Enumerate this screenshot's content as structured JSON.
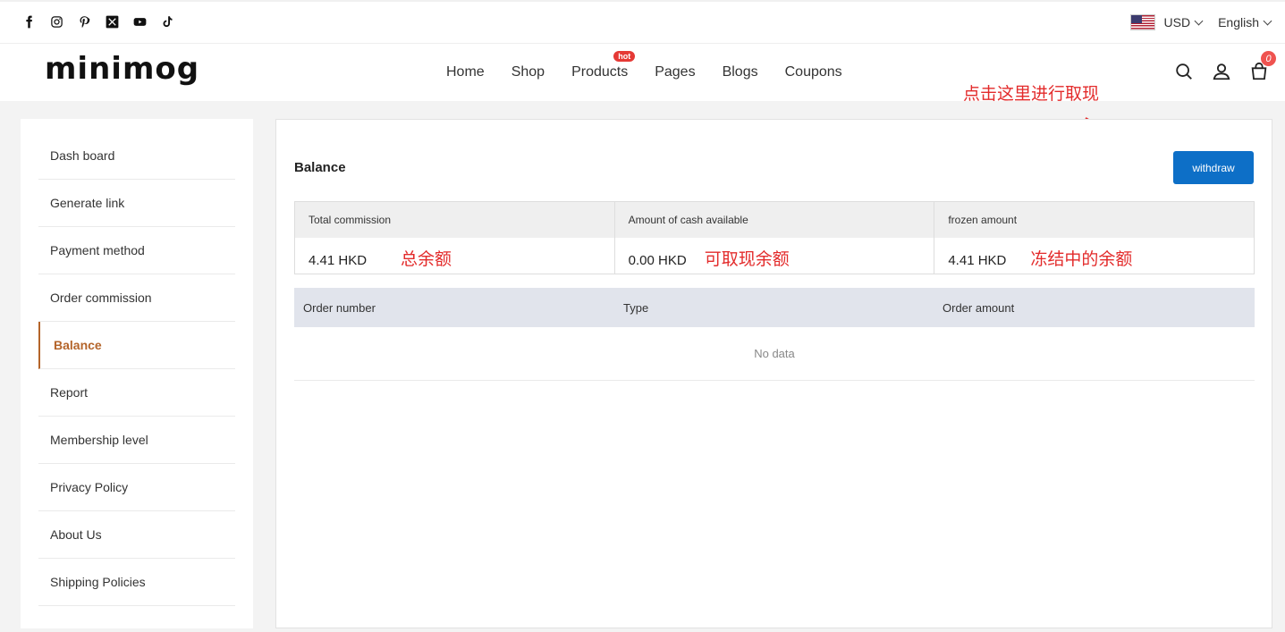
{
  "topbar": {
    "social_icons": [
      "facebook-icon",
      "instagram-icon",
      "pinterest-icon",
      "x-twitter-icon",
      "youtube-icon",
      "tiktok-icon"
    ],
    "currency": "USD",
    "language": "English"
  },
  "header": {
    "logo": "minimog",
    "nav": [
      {
        "label": "Home"
      },
      {
        "label": "Shop"
      },
      {
        "label": "Products",
        "badge": "hot"
      },
      {
        "label": "Pages"
      },
      {
        "label": "Blogs"
      },
      {
        "label": "Coupons"
      }
    ],
    "cart_count": "0"
  },
  "annotations": {
    "withdraw_hint": "点击这里进行取现",
    "total_hint": "总余额",
    "available_hint": "可取现余额",
    "frozen_hint": "冻结中的余额"
  },
  "sidebar": {
    "items": [
      {
        "label": "Dash board"
      },
      {
        "label": "Generate link"
      },
      {
        "label": "Payment method"
      },
      {
        "label": "Order commission"
      },
      {
        "label": "Balance"
      },
      {
        "label": "Report"
      },
      {
        "label": "Membership level"
      },
      {
        "label": "Privacy Policy"
      },
      {
        "label": "About Us"
      },
      {
        "label": "Shipping Policies"
      }
    ],
    "active": "Balance"
  },
  "main": {
    "title": "Balance",
    "withdraw_label": "withdraw",
    "summary": [
      {
        "label": "Total commission",
        "value": "4.41 HKD"
      },
      {
        "label": "Amount of cash available",
        "value": "0.00 HKD"
      },
      {
        "label": "frozen amount",
        "value": "4.41 HKD"
      }
    ],
    "table": {
      "columns": [
        "Order number",
        "Type",
        "Order amount"
      ],
      "empty_text": "No data"
    }
  },
  "colors": {
    "accent": "#b4642a",
    "button": "#0d6fc7",
    "annotation": "#e32b2b"
  }
}
